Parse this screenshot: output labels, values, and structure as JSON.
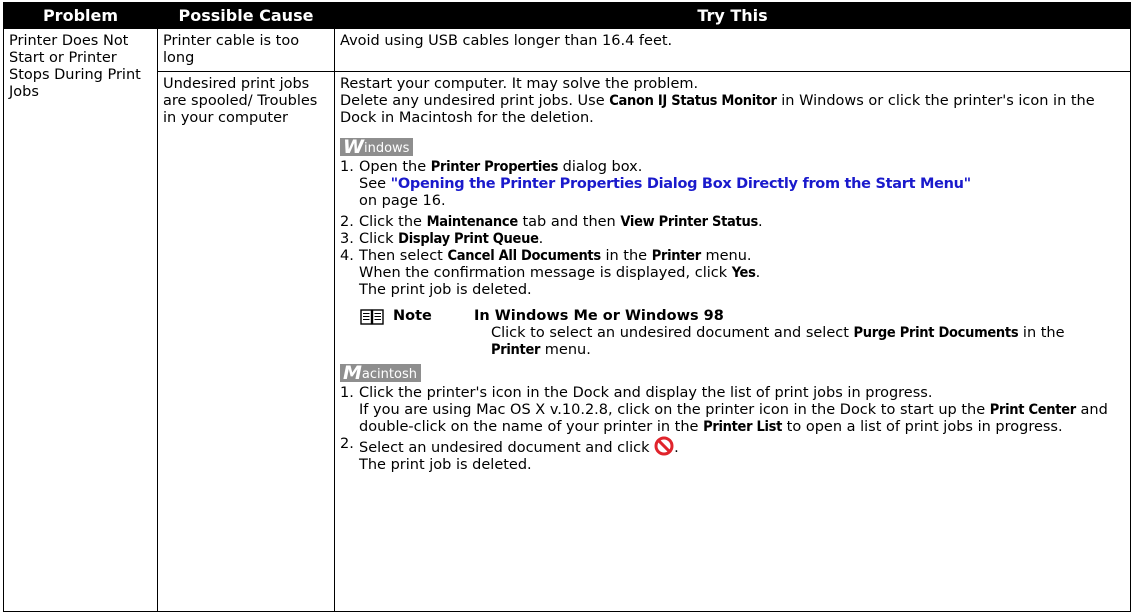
{
  "headers": {
    "problem": "Problem",
    "cause": "Possible Cause",
    "try": "Try This"
  },
  "problem": "Printer Does Not Start or Printer Stops During Print Jobs",
  "row1": {
    "cause": "Printer cable is too long",
    "try": "Avoid using USB cables longer than 16.4 feet."
  },
  "row2": {
    "cause": "Undesired print jobs are spooled/ Troubles in your computer",
    "intro1": "Restart your computer. It may solve the problem.",
    "intro2_a": "Delete any undesired print jobs. Use ",
    "intro2_b": "Canon IJ Status Monitor",
    "intro2_c": " in Windows or click the printer's icon in the Dock in Macintosh for the deletion.",
    "windows_badge": {
      "initial": "W",
      "rest": "indows"
    },
    "win_steps": {
      "s1_n": "1.",
      "s1_a": "Open the ",
      "s1_b": "Printer Properties",
      "s1_c": " dialog box.",
      "s1_see": "See ",
      "s1_link": "\"Opening the Printer Properties Dialog Box Directly from the Start Menu\"",
      "s1_page": " on page 16.",
      "s2_n": "2.",
      "s2_a": "Click the ",
      "s2_b": "Maintenance",
      "s2_c": " tab and then ",
      "s2_d": "View Printer Status",
      "s2_e": ".",
      "s3_n": "3.",
      "s3_a": "Click ",
      "s3_b": "Display Print Queue",
      "s3_c": ".",
      "s4_n": "4.",
      "s4_a": "Then select ",
      "s4_b": "Cancel All Documents",
      "s4_c": " in the ",
      "s4_d": "Printer",
      "s4_e": " menu.",
      "s4_l2a": "When the confirmation message is displayed, click ",
      "s4_l2b": "Yes",
      "s4_l2c": ".",
      "s4_l3": "The print job is deleted."
    },
    "note": {
      "label": "Note",
      "head": "In Windows Me or Windows 98",
      "a": "Click to select an undesired document and select ",
      "b": "Purge Print Documents",
      "c": " in the ",
      "d": "Printer",
      "e": " menu."
    },
    "mac_badge": {
      "initial": "M",
      "rest": "acintosh"
    },
    "mac_steps": {
      "s1_n": "1.",
      "s1_a": "Click the printer's icon in the Dock and display the list of print jobs in progress.",
      "s1_b": "If you are using Mac OS X v.10.2.8, click on the printer icon in the Dock to start up the ",
      "s1_c": "Print Center",
      "s1_d": " and double-click on the name of your printer in the ",
      "s1_e": "Printer List",
      "s1_f": " to open a list of print jobs in progress.",
      "s2_n": "2.",
      "s2_a": "Select an undesired document and click ",
      "s2_b": ".",
      "s2_c": "The print job is deleted."
    }
  },
  "colors": {
    "header_bg": "#000000",
    "link": "#1a1acc",
    "badge_bg": "#8e8e8e",
    "prohibit": "#e0242c"
  },
  "icons": {
    "note": "book-icon",
    "delete": "prohibit-icon"
  }
}
